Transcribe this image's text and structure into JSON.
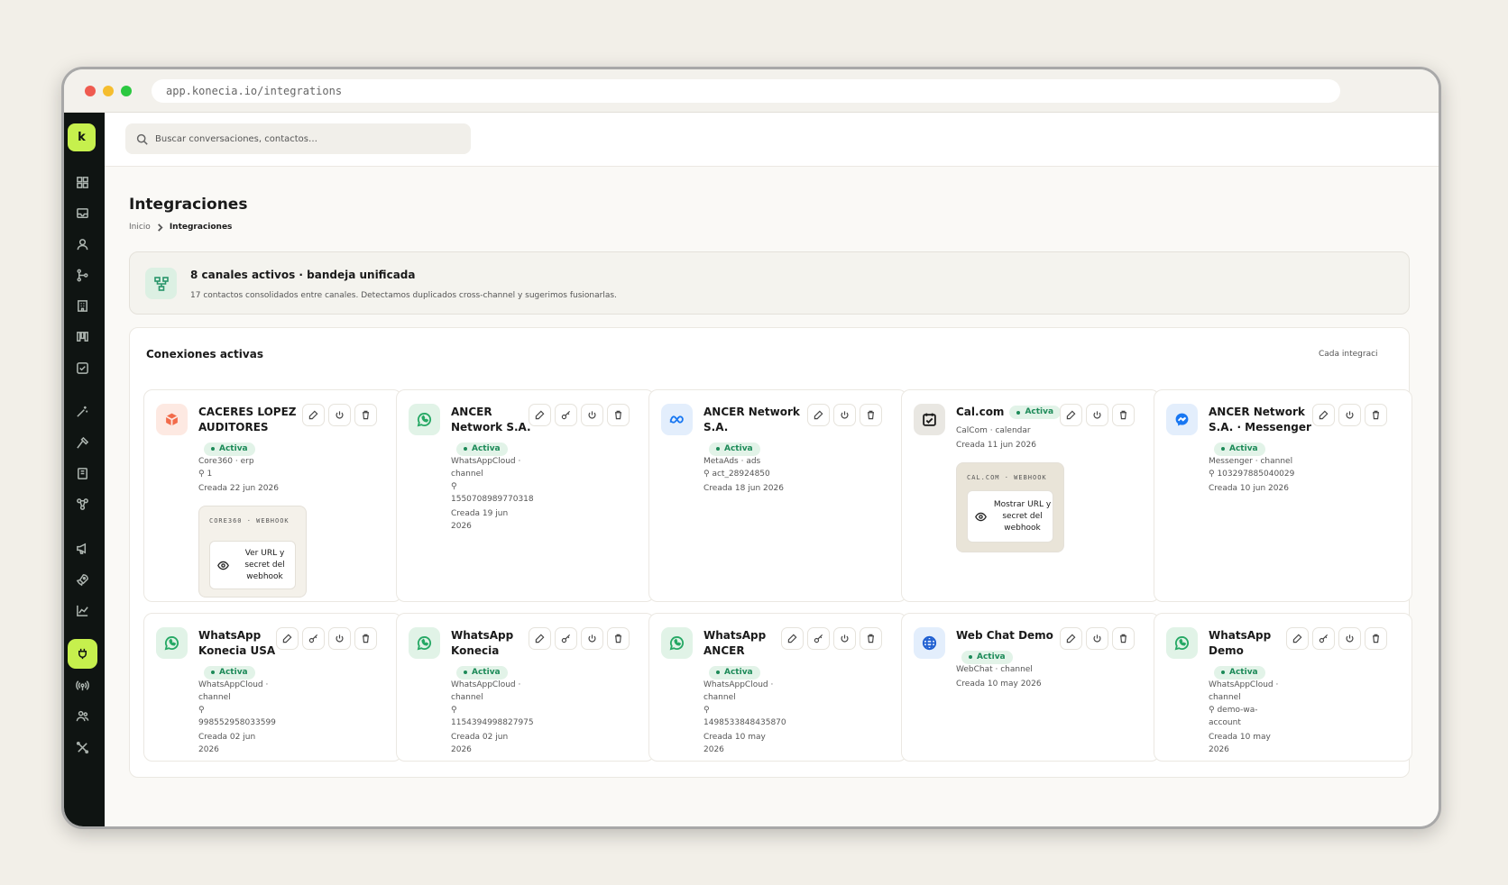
{
  "browser": {
    "url": "app.konecia.io/integrations",
    "dots": [
      "#ef5b50",
      "#f5bd2e",
      "#2bc840"
    ]
  },
  "sidebar": {
    "logo": "k",
    "items": [
      {
        "icon": "grid-icon"
      },
      {
        "icon": "inbox-icon"
      },
      {
        "icon": "user-icon"
      },
      {
        "icon": "branch-icon"
      },
      {
        "icon": "building-icon"
      },
      {
        "icon": "kanban-icon"
      },
      {
        "icon": "checkbox-icon"
      },
      {
        "icon": "magic-wand-icon"
      },
      {
        "icon": "hammer-icon"
      },
      {
        "icon": "book-icon"
      },
      {
        "icon": "workflow-icon"
      },
      {
        "icon": "megaphone-icon"
      },
      {
        "icon": "rocket-icon"
      },
      {
        "icon": "chart-icon"
      },
      {
        "icon": "plug-icon",
        "active": true
      },
      {
        "icon": "broadcast-icon"
      },
      {
        "icon": "team-icon"
      },
      {
        "icon": "tools-icon"
      }
    ]
  },
  "search": {
    "placeholder": "Buscar conversaciones, contactos…"
  },
  "page": {
    "title": "Integraciones",
    "breadcrumb": [
      "Inicio",
      "Integraciones"
    ]
  },
  "banner": {
    "title": "8 canales activos · bandeja unificada",
    "subtitle": "17 contactos consolidados entre canales. Detectamos duplicados cross-channel y sugerimos fusionarlas."
  },
  "connections": {
    "title": "Conexiones activas",
    "note": "Cada integraci",
    "cards": [
      {
        "name_lines": [
          "CACERES LOPEZ",
          "AUDITORES"
        ],
        "badge": "Activa",
        "badge_inline": false,
        "meta_lines": [
          "Core360 · erp",
          "⚲ 1",
          "Creada 22 jun 2026"
        ],
        "icon": "cube-icon",
        "accent": "#f26b4a",
        "tint": "#fde9e2",
        "actions": [
          "edit",
          "power",
          "delete"
        ],
        "webhook": {
          "label": "CORE360 · WEBHOOK",
          "button": "Ver URL y secret del webhook"
        }
      },
      {
        "name_lines": [
          "ANCER",
          "Network S.A."
        ],
        "badge": "Activa",
        "badge_inline": false,
        "meta_lines": [
          "WhatsAppCloud ·",
          "channel",
          "⚲",
          "1550708989770318",
          "Creada 19 jun",
          "2026"
        ],
        "icon": "whatsapp-icon",
        "accent": "#25a864",
        "tint": "#e1f3e7",
        "actions": [
          "edit",
          "key",
          "power",
          "delete"
        ]
      },
      {
        "name_lines": [
          "ANCER Network",
          "S.A."
        ],
        "badge": "Activa",
        "badge_inline": false,
        "meta_lines": [
          "MetaAds · ads",
          "⚲ act_28924850",
          "Creada 18 jun 2026"
        ],
        "icon": "meta-icon",
        "accent": "#1877f2",
        "tint": "#e3eefc",
        "actions": [
          "edit",
          "power",
          "delete"
        ]
      },
      {
        "name_lines": [
          "Cal.com"
        ],
        "badge": "Activa",
        "badge_inline": true,
        "meta_lines": [
          "CalCom · calendar",
          "Creada 11 jun 2026"
        ],
        "icon": "calendar-check-icon",
        "accent": "#1a1a1a",
        "tint": "#e9e7e2",
        "actions": [
          "edit",
          "power",
          "delete"
        ],
        "webhook": {
          "label": "CAL.COM · WEBHOOK",
          "button": "Mostrar URL y secret del webhook",
          "dark": true
        }
      },
      {
        "name_lines": [
          "ANCER Network",
          "S.A. · Messenger"
        ],
        "badge": "Activa",
        "badge_inline": false,
        "meta_lines": [
          "Messenger · channel",
          "⚲ 103297885040029",
          "Creada 10 jun 2026"
        ],
        "icon": "messenger-icon",
        "accent": "#1877f2",
        "tint": "#e3eefc",
        "actions": [
          "edit",
          "power",
          "delete"
        ]
      },
      {
        "name_lines": [
          "WhatsApp",
          "Konecia USA"
        ],
        "badge": "Activa",
        "badge_inline": false,
        "meta_lines": [
          "WhatsAppCloud ·",
          "channel",
          "⚲",
          "998552958033599",
          "Creada 02 jun",
          "2026"
        ],
        "icon": "whatsapp-icon",
        "accent": "#25a864",
        "tint": "#e1f3e7",
        "actions": [
          "edit",
          "key",
          "power",
          "delete"
        ]
      },
      {
        "name_lines": [
          "WhatsApp",
          "Konecia"
        ],
        "badge": "Activa",
        "badge_inline": false,
        "meta_lines": [
          "WhatsAppCloud ·",
          "channel",
          "⚲",
          "1154394998827975",
          "Creada 02 jun",
          "2026"
        ],
        "icon": "whatsapp-icon",
        "accent": "#25a864",
        "tint": "#e1f3e7",
        "actions": [
          "edit",
          "key",
          "power",
          "delete"
        ]
      },
      {
        "name_lines": [
          "WhatsApp",
          "ANCER"
        ],
        "badge": "Activa",
        "badge_inline": false,
        "meta_lines": [
          "WhatsAppCloud ·",
          "channel",
          "⚲",
          "1498533848435870",
          "Creada 10 may",
          "2026"
        ],
        "icon": "whatsapp-icon",
        "accent": "#25a864",
        "tint": "#e1f3e7",
        "actions": [
          "edit",
          "key",
          "power",
          "delete"
        ]
      },
      {
        "name_lines": [
          "Web Chat Demo"
        ],
        "badge": "Activa",
        "badge_inline": false,
        "meta_lines": [
          "WebChat · channel",
          "Creada 10 may 2026"
        ],
        "icon": "globe-icon",
        "accent": "#1f5fd1",
        "tint": "#e3eefc",
        "actions": [
          "edit",
          "power",
          "delete"
        ]
      },
      {
        "name_lines": [
          "WhatsApp",
          "Demo"
        ],
        "badge": "Activa",
        "badge_inline": false,
        "meta_lines": [
          "WhatsAppCloud ·",
          "channel",
          "⚲ demo-wa-",
          "account",
          "Creada 10 may",
          "2026"
        ],
        "icon": "whatsapp-icon",
        "accent": "#25a864",
        "tint": "#e1f3e7",
        "actions": [
          "edit",
          "key",
          "power",
          "delete"
        ]
      }
    ]
  }
}
